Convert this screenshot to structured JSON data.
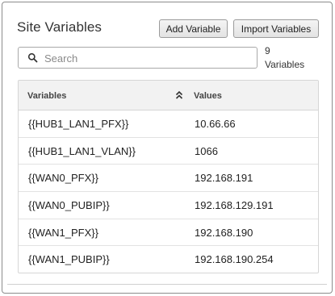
{
  "header": {
    "title": "Site Variables",
    "add_label": "Add Variable",
    "import_label": "Import Variables"
  },
  "search": {
    "placeholder": "Search",
    "count_number": "9",
    "count_label": "Variables"
  },
  "table": {
    "columns": [
      "Variables",
      "Values"
    ],
    "rows": [
      {
        "variable": "{{HUB1_LAN1_PFX}}",
        "value": "10.66.66"
      },
      {
        "variable": "{{HUB1_LAN1_VLAN}}",
        "value": "1066"
      },
      {
        "variable": "{{WAN0_PFX}}",
        "value": "192.168.191"
      },
      {
        "variable": "{{WAN0_PUBIP}}",
        "value": "192.168.129.191"
      },
      {
        "variable": "{{WAN1_PFX}}",
        "value": "192.168.190"
      },
      {
        "variable": "{{WAN1_PUBIP}}",
        "value": "192.168.190.254"
      }
    ]
  }
}
